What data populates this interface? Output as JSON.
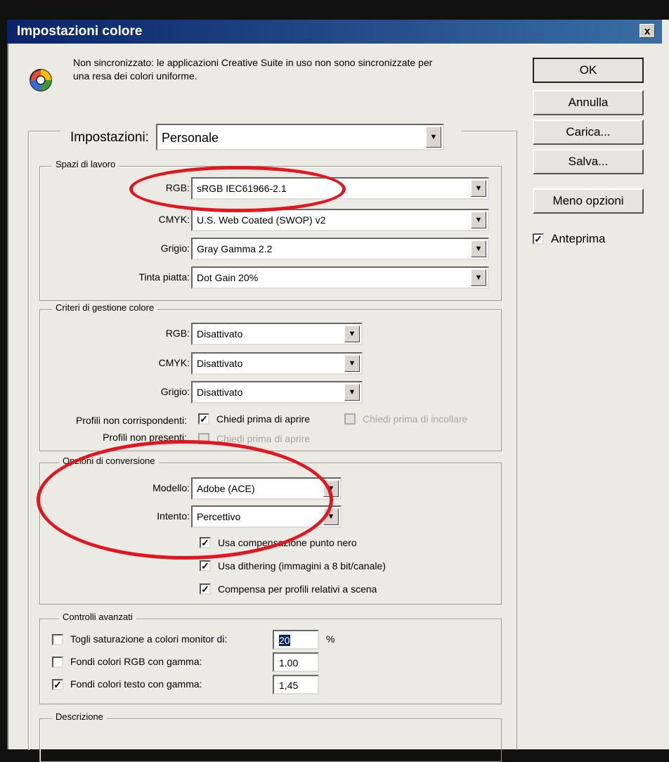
{
  "window": {
    "title": "Impostazioni colore",
    "close_label": "x"
  },
  "sync_message": "Non sincronizzato: le applicazioni Creative Suite in uso non sono sincronizzate per una resa dei colori uniforme.",
  "buttons": {
    "ok": "OK",
    "cancel": "Annulla",
    "load": "Carica...",
    "save": "Salva...",
    "fewer_options": "Meno opzioni"
  },
  "preview": {
    "label": "Anteprima",
    "checked": true
  },
  "settings": {
    "label": "Impostazioni:",
    "value": "Personale"
  },
  "working_spaces": {
    "title": "Spazi di lavoro",
    "rgb_label": "RGB:",
    "rgb_value": "sRGB IEC61966-2.1",
    "cmyk_label": "CMYK:",
    "cmyk_value": "U.S. Web Coated (SWOP) v2",
    "gray_label": "Grigio:",
    "gray_value": "Gray Gamma 2.2",
    "spot_label": "Tinta piatta:",
    "spot_value": "Dot Gain 20%"
  },
  "color_policies": {
    "title": "Criteri di gestione colore",
    "rgb_label": "RGB:",
    "rgb_value": "Disattivato",
    "cmyk_label": "CMYK:",
    "cmyk_value": "Disattivato",
    "gray_label": "Grigio:",
    "gray_value": "Disattivato",
    "mismatch_label": "Profili non corrispondenti:",
    "ask_open": "Chiedi prima di aprire",
    "ask_paste": "Chiedi prima di incollare",
    "missing_label": "Profili non presenti:",
    "missing_ask_open": "Chiedi prima di aprire"
  },
  "conversion": {
    "title": "Opzioni di conversione",
    "engine_label": "Modello:",
    "engine_value": "Adobe (ACE)",
    "intent_label": "Intento:",
    "intent_value": "Percettivo",
    "bpc": "Usa compensazione punto nero",
    "dither": "Usa dithering (immagini a 8 bit/canale)",
    "scene": "Compensa per profili relativi a scena"
  },
  "advanced": {
    "title": "Controlli avanzati",
    "desaturate": "Togli saturazione a colori monitor di:",
    "desaturate_value": "20",
    "percent": "%",
    "blend_rgb": "Fondi colori RGB con gamma:",
    "blend_rgb_value": "1.00",
    "blend_text": "Fondi colori testo con gamma:",
    "blend_text_value": "1,45"
  },
  "description": {
    "title": "Descrizione"
  },
  "colors": {
    "annotation_red": "#e3161f",
    "titlebar": "#0a246a"
  }
}
